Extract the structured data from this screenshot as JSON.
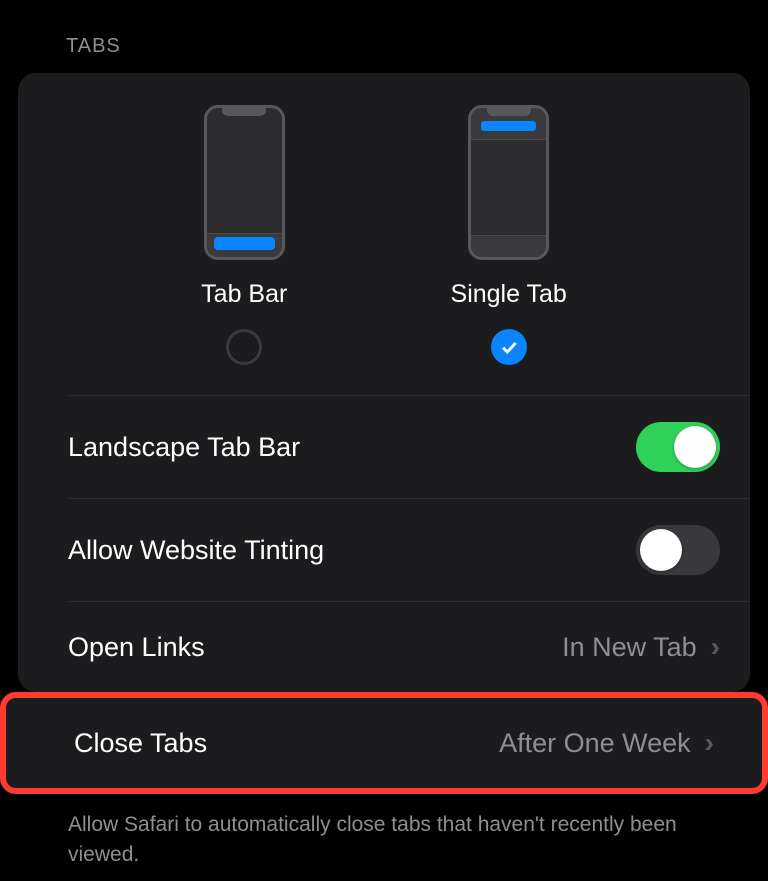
{
  "section_header": "TABS",
  "layout": {
    "tab_bar": {
      "label": "Tab Bar",
      "selected": false
    },
    "single_tab": {
      "label": "Single Tab",
      "selected": true
    }
  },
  "rows": {
    "landscape_tab_bar": {
      "label": "Landscape Tab Bar",
      "value_on": true
    },
    "allow_website_tinting": {
      "label": "Allow Website Tinting",
      "value_on": false
    },
    "open_links": {
      "label": "Open Links",
      "value": "In New Tab"
    },
    "close_tabs": {
      "label": "Close Tabs",
      "value": "After One Week"
    }
  },
  "footer": "Allow Safari to automatically close tabs that haven't recently been viewed.",
  "colors": {
    "accent": "#0a84ff",
    "switch_on": "#30d158",
    "highlight": "#ff3b30"
  }
}
